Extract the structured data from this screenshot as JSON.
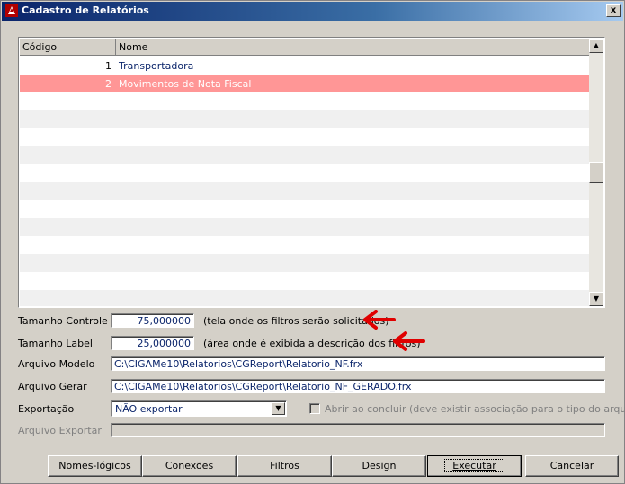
{
  "window": {
    "title": "Cadastro de Relatórios",
    "close_label": "x"
  },
  "grid": {
    "columns": [
      "Código",
      "Nome"
    ],
    "rows": [
      {
        "code": "1",
        "name": "Transportadora",
        "selected": false
      },
      {
        "code": "2",
        "name": "Movimentos de Nota Fiscal",
        "selected": true
      }
    ],
    "scroll_up": "▲",
    "scroll_down": "▼"
  },
  "form": {
    "tamanho_controle": {
      "label": "Tamanho Controle",
      "value": "75,000000",
      "hint": "(tela onde os filtros serão solicitados)"
    },
    "tamanho_label": {
      "label": "Tamanho Label",
      "value": "25,000000",
      "hint": "(área onde é exibida a descrição dos filtros)"
    },
    "arquivo_modelo": {
      "label": "Arquivo Modelo",
      "value": "C:\\CIGAMe10\\Relatorios\\CGReport\\Relatorio_NF.frx"
    },
    "arquivo_gerar": {
      "label": "Arquivo Gerar",
      "value": "C:\\CIGAMe10\\Relatorios\\CGReport\\Relatorio_NF_GERADO.frx"
    },
    "exportacao": {
      "label": "Exportação",
      "value": "NÃO exportar",
      "dropdown_icon": "▼"
    },
    "abrir_ao_concluir": {
      "label": "Abrir ao concluir (deve existir associação para o tipo do arquivo)",
      "checked": false
    },
    "arquivo_exportar": {
      "label": "Arquivo Exportar",
      "value": ""
    }
  },
  "buttons": {
    "nomes_logicos": "Nomes-lógicos",
    "conexoes": "Conexões",
    "filtros": "Filtros",
    "design": "Design",
    "executar": "Executar",
    "cancelar": "Cancelar"
  },
  "colors": {
    "selected_row": "#ff9696",
    "annotation_arrow": "#e00000",
    "title_bar": "#0a246a"
  }
}
